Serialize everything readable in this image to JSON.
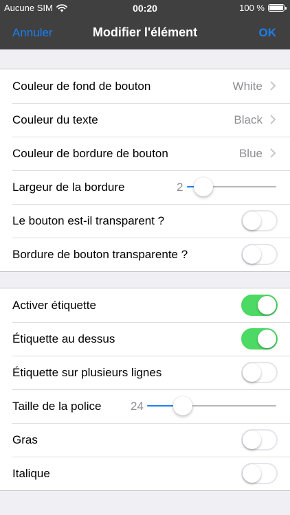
{
  "status_bar": {
    "carrier": "Aucune SIM",
    "time": "00:20",
    "battery": "100 %"
  },
  "navbar": {
    "cancel_label": "Annuler",
    "title": "Modifier l'élément",
    "ok_label": "OK"
  },
  "colors": {
    "accent": "#1a7ff2",
    "toggle_on": "#4cd964",
    "nav_bg": "#404040"
  },
  "section1": {
    "bg_color": {
      "label": "Couleur de fond de bouton",
      "value": "White"
    },
    "text_color": {
      "label": "Couleur du texte",
      "value": "Black"
    },
    "border_color": {
      "label": "Couleur de bordure de bouton",
      "value": "Blue"
    },
    "border_width": {
      "label": "Largeur de la bordure",
      "value": "2",
      "min": 0,
      "max": 20
    },
    "transparent": {
      "label": "Le bouton est-il transparent ?",
      "on": false
    },
    "border_transparent": {
      "label": "Bordure de bouton transparente ?",
      "on": false
    }
  },
  "section2": {
    "enable_label": {
      "label": "Activer étiquette",
      "on": true
    },
    "label_above": {
      "label": "Étiquette au dessus",
      "on": true
    },
    "multiline": {
      "label": "Étiquette sur plusieurs lignes",
      "on": false
    },
    "font_size": {
      "label": "Taille de la police",
      "value": "24",
      "min": 0,
      "max": 100
    },
    "bold": {
      "label": "Gras",
      "on": false
    },
    "italic": {
      "label": "Italique",
      "on": false
    }
  }
}
